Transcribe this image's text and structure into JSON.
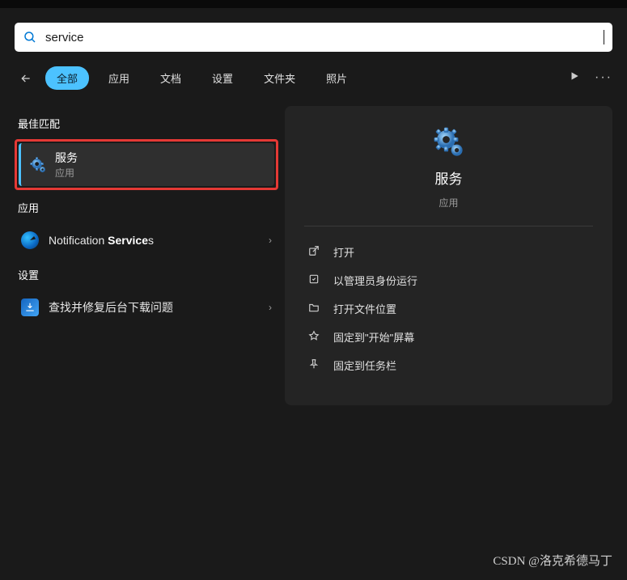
{
  "search": {
    "query": "service"
  },
  "filters": {
    "items": [
      "全部",
      "应用",
      "文档",
      "设置",
      "文件夹",
      "照片"
    ],
    "active_index": 0
  },
  "sections": {
    "best_match": "最佳匹配",
    "apps": "应用",
    "settings": "设置"
  },
  "best_match": {
    "title": "服务",
    "subtitle": "应用"
  },
  "apps": [
    {
      "label_prefix": "Notification ",
      "label_bold": "Service",
      "label_suffix": "s",
      "icon": "edge"
    }
  ],
  "settings_items": [
    {
      "label": "查找并修复后台下载问题",
      "icon": "download"
    }
  ],
  "preview": {
    "title": "服务",
    "subtitle": "应用",
    "actions": [
      {
        "icon": "open",
        "label": "打开"
      },
      {
        "icon": "admin",
        "label": "以管理员身份运行"
      },
      {
        "icon": "folder",
        "label": "打开文件位置"
      },
      {
        "icon": "pin-start",
        "label": "固定到\"开始\"屏幕"
      },
      {
        "icon": "pin-task",
        "label": "固定到任务栏"
      }
    ]
  },
  "watermark": "CSDN @洛克希德马丁"
}
